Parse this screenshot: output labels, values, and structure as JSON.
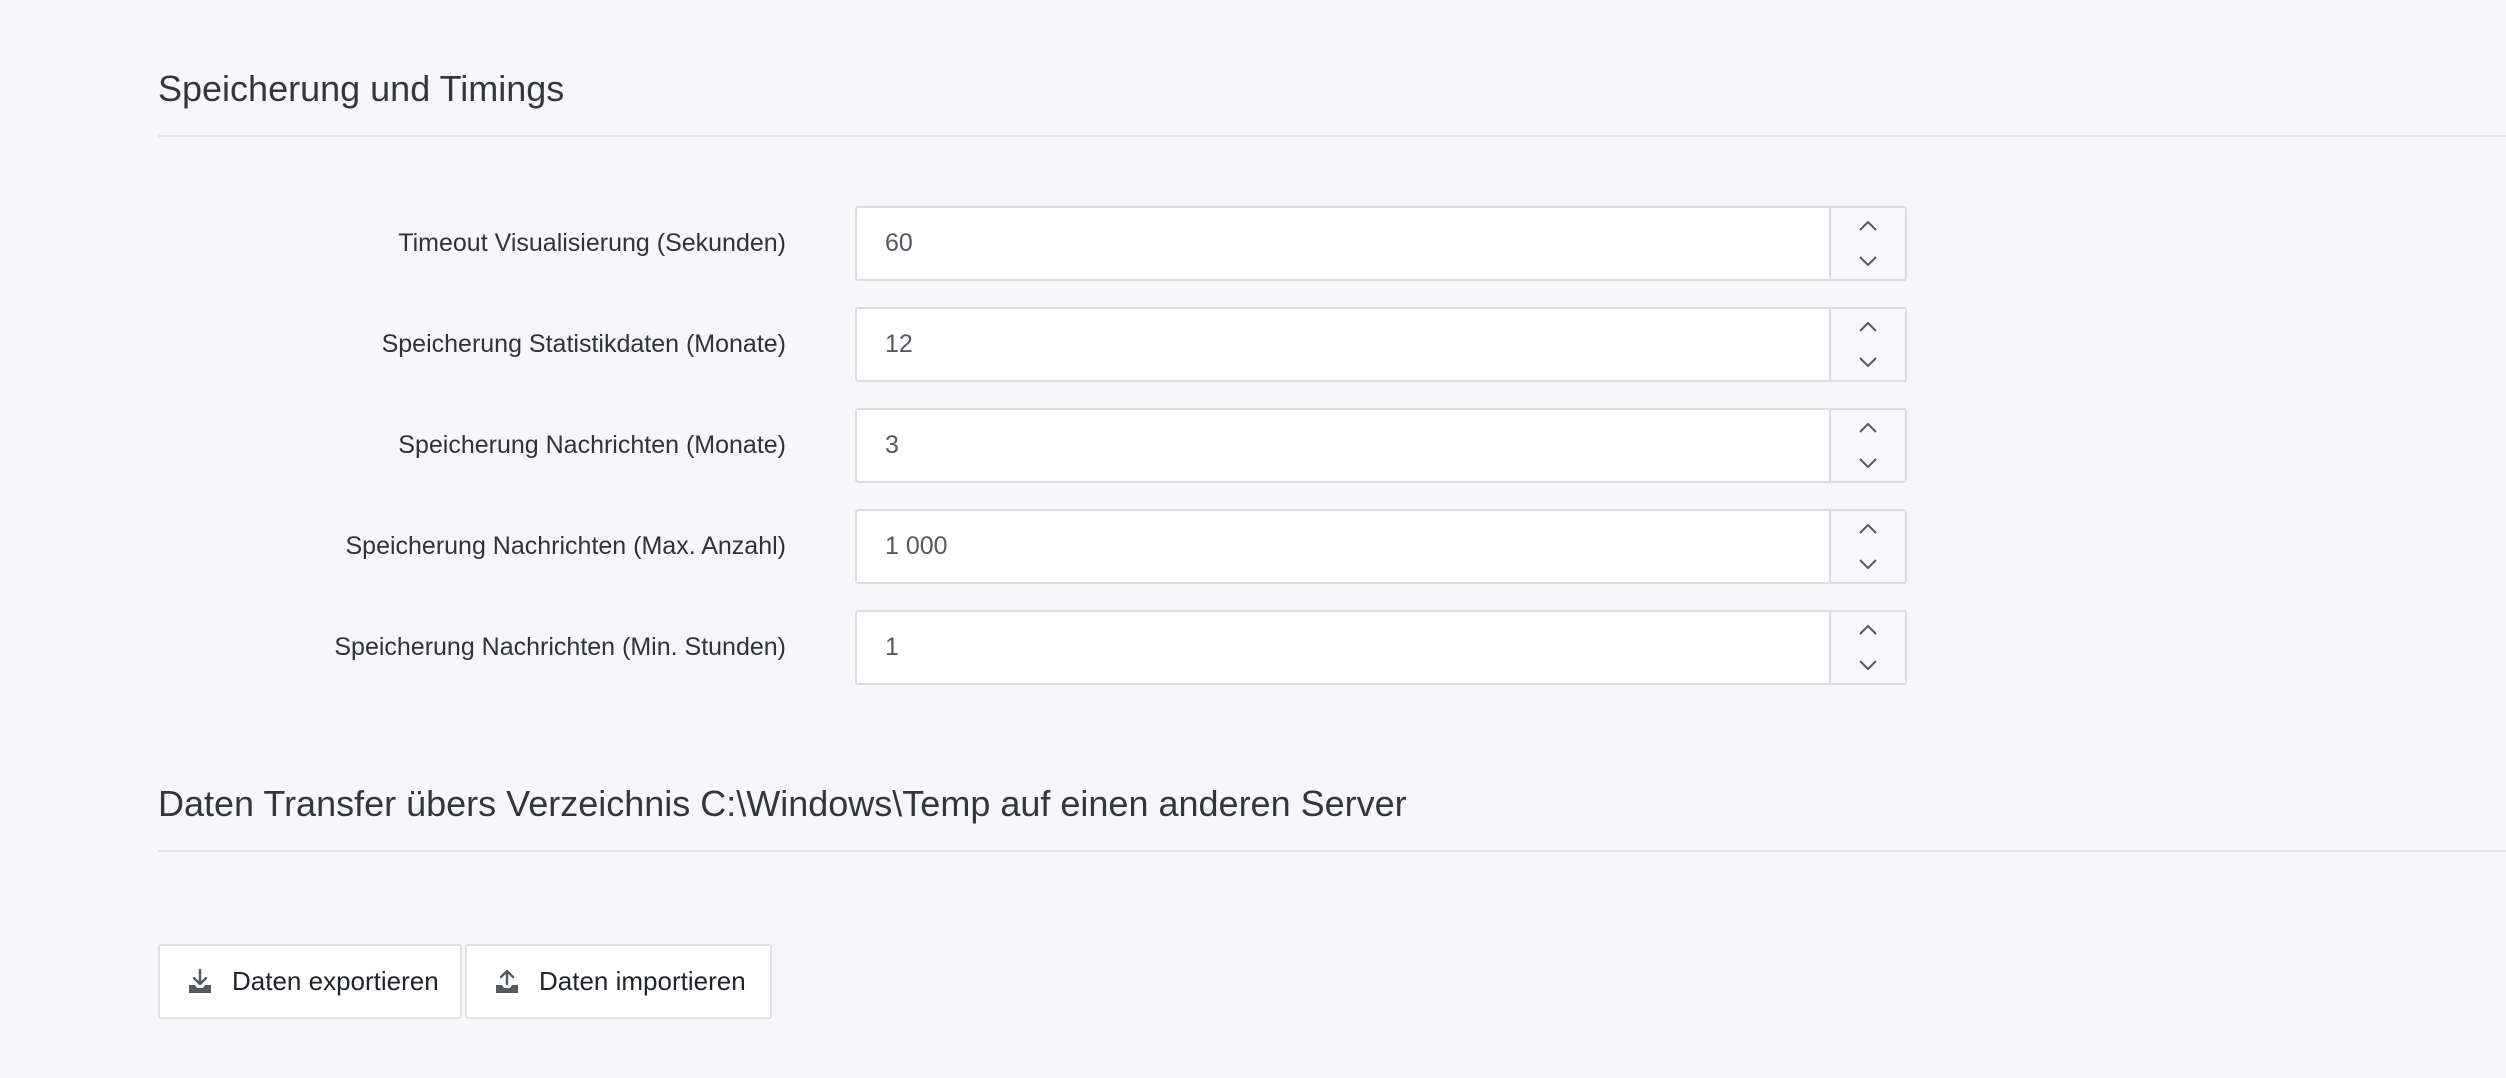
{
  "storage_section": {
    "title": "Speicherung und Timings",
    "fields": [
      {
        "label": "Timeout Visualisierung (Sekunden)",
        "value": "60"
      },
      {
        "label": "Speicherung Statistikdaten (Monate)",
        "value": "12"
      },
      {
        "label": "Speicherung Nachrichten (Monate)",
        "value": "3"
      },
      {
        "label": "Speicherung Nachrichten (Max. Anzahl)",
        "value": "1 000"
      },
      {
        "label": "Speicherung Nachrichten (Min. Stunden)",
        "value": "1"
      }
    ]
  },
  "transfer_section": {
    "title": "Daten Transfer übers Verzeichnis C:\\Windows\\Temp auf einen anderen Server",
    "export_label": "Daten exportieren",
    "import_label": "Daten importieren"
  },
  "icons": {
    "export": "download-tray-icon",
    "import": "upload-tray-icon",
    "spin_up": "chevron-up-icon",
    "spin_down": "chevron-down-icon"
  },
  "colors": {
    "background": "#f7f7f9",
    "text": "#33373d",
    "border": "#dcdde1",
    "icon": "#555a61"
  }
}
